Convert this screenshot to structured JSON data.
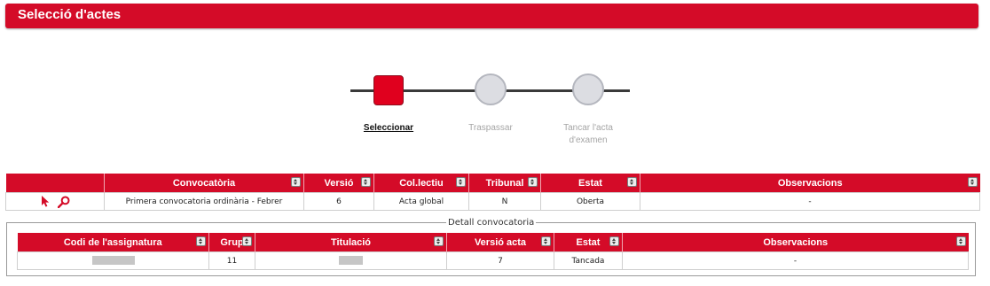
{
  "page": {
    "title": "Selecció d'actes"
  },
  "steps": [
    {
      "label": "Seleccionar",
      "state": "active"
    },
    {
      "label": "Traspassar",
      "state": "inactive"
    },
    {
      "label": "Tancar l'acta d'examen",
      "state": "inactive"
    }
  ],
  "main_table": {
    "columns": [
      "Convocatòria",
      "Versió",
      "Col.lectiu",
      "Tribunal",
      "Estat",
      "Observacions"
    ],
    "rows": [
      {
        "convocatoria": "Primera convocatoria ordinària - Febrer",
        "versio": "6",
        "collectiu": "Acta global",
        "tribunal": "N",
        "estat": "Oberta",
        "observacions": "-"
      }
    ]
  },
  "detail": {
    "legend": "Detall convocatoria",
    "columns": [
      "Codi de l'assignatura",
      "Grup",
      "Titulació",
      "Versió acta",
      "Estat",
      "Observacions"
    ],
    "rows": [
      {
        "codi": "",
        "grup": "11",
        "titulacio": "",
        "versio_acta": "7",
        "estat": "Tancada",
        "observacions": "-"
      }
    ]
  },
  "icons": {
    "select": "cursor-icon",
    "view": "magnifier-icon",
    "sort": "sort-icon"
  },
  "colors": {
    "accent": "#d40b28",
    "step_active": "#e0001e",
    "step_inactive": "#dcdde2"
  }
}
